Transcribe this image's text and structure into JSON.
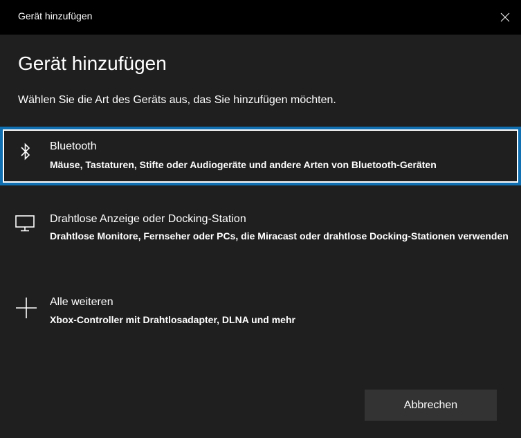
{
  "window": {
    "title": "Gerät hinzufügen"
  },
  "heading": "Gerät hinzufügen",
  "subtitle": "Wählen Sie die Art des Geräts aus, das Sie hinzufügen möchten.",
  "options": [
    {
      "icon": "bluetooth-icon",
      "title": "Bluetooth",
      "description": "Mäuse, Tastaturen, Stifte oder Audiogeräte und andere Arten von Bluetooth-Geräten",
      "selected": true
    },
    {
      "icon": "monitor-icon",
      "title": "Drahtlose Anzeige oder Docking-Station",
      "description": "Drahtlose Monitore, Fernseher oder PCs, die Miracast oder drahtlose Docking-Stationen verwenden",
      "selected": false
    },
    {
      "icon": "plus-icon",
      "title": "Alle weiteren",
      "description": "Xbox-Controller mit Drahtlosadapter, DLNA und mehr",
      "selected": false
    }
  ],
  "buttons": {
    "cancel_label": "Abbrechen"
  },
  "colors": {
    "background": "#1f1f1f",
    "titlebar": "#000000",
    "selection_accent": "#0f6fb0",
    "button_background": "#333333",
    "text": "#ffffff"
  }
}
